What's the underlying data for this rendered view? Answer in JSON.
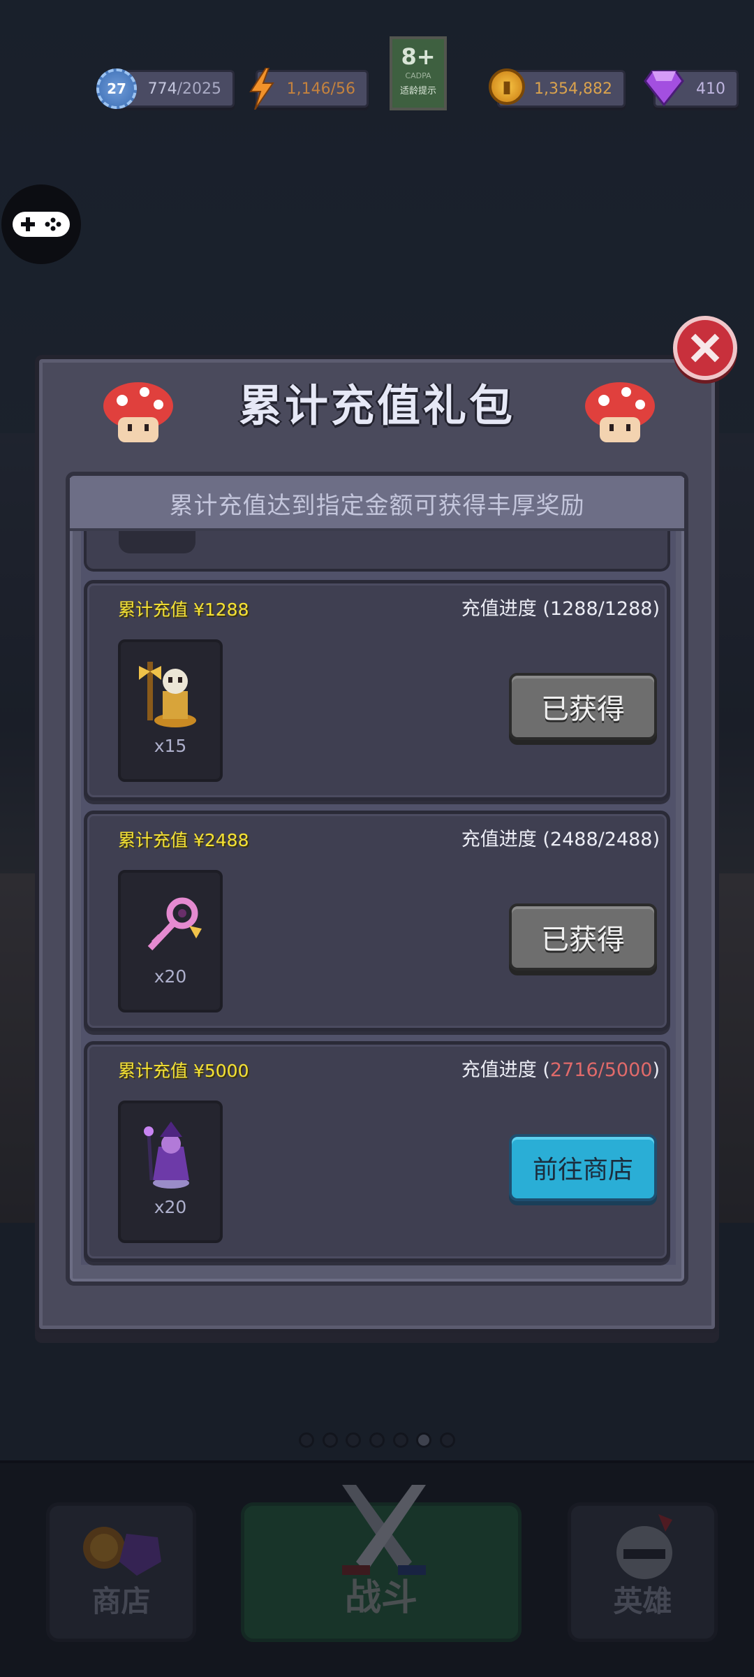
{
  "status_bar": {
    "level": "27",
    "xp_current": "774",
    "xp_max": "/2025",
    "energy_current": "1,146",
    "energy_max": "/56",
    "coins": "1,354,882",
    "gems": "410",
    "age_rating": "8+",
    "age_rating_org": "CADPA",
    "age_rating_tip": "适龄提示",
    "icons": [
      "gear-level-icon",
      "lightning-energy-icon",
      "gold-coin-icon",
      "purple-gem-icon"
    ]
  },
  "dialog": {
    "title": "累计充值礼包",
    "subtitle": "累计充值达到指定金额可获得丰厚奖励",
    "progress_label": "充值进度",
    "tiers": [
      {
        "amount_label": "累计充值 ¥1288",
        "progress_open": " (",
        "progress_value": "1288/1288",
        "progress_close": ")",
        "reward_item": "golden-skeleton-warrior-icon",
        "reward_qty": "x15",
        "button_label": "已获得",
        "button_state": "claimed"
      },
      {
        "amount_label": "累计充值 ¥2488",
        "progress_open": " (",
        "progress_value": "2488/2488",
        "progress_close": ")",
        "reward_item": "pink-key-icon",
        "reward_qty": "x20",
        "button_label": "已获得",
        "button_state": "claimed"
      },
      {
        "amount_label": "累计充值 ¥5000",
        "progress_open": " (",
        "progress_value": "2716/5000",
        "progress_close": ")",
        "reward_item": "purple-mage-hero-icon",
        "reward_qty": "x20",
        "button_label": "前往商店",
        "button_state": "go_shop"
      }
    ]
  },
  "pager": {
    "total": 7,
    "active": 6
  },
  "bottom_nav": {
    "shop": "商店",
    "battle": "战斗",
    "hero": "英雄"
  },
  "colors": {
    "gold_text": "#f5e233",
    "progress_short": "#e06a6a",
    "close_button": "#c8303c",
    "shop_button": "#2aaed6",
    "claimed_button": "#6e6e6e"
  }
}
